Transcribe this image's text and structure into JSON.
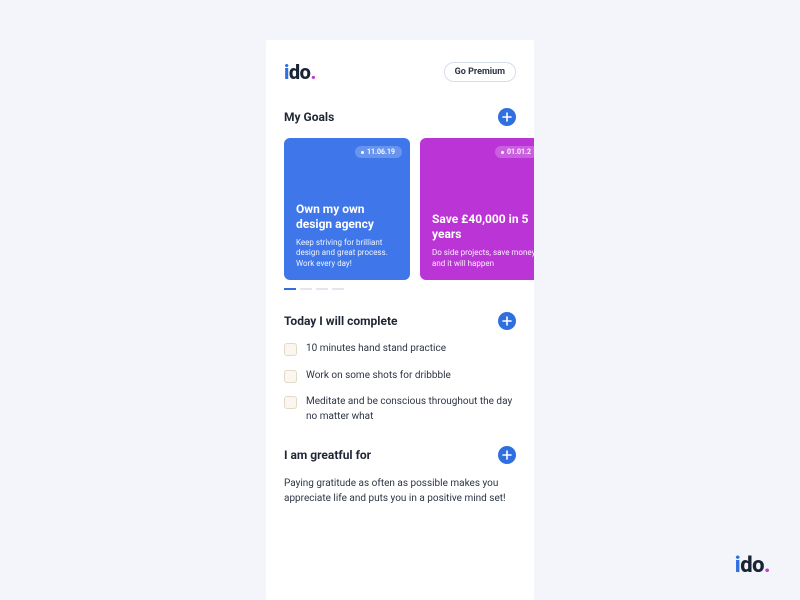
{
  "brand": {
    "name": "ido",
    "dot": "."
  },
  "header": {
    "premium_label": "Go Premium"
  },
  "colors": {
    "primary": "#2f6fe0",
    "accent": "#c23bd6",
    "card1_bg": "#3f77ea",
    "card2_bg": "#bb34d6"
  },
  "goals": {
    "title": "My Goals",
    "cards": [
      {
        "date": "11.06.19",
        "title": "Own my own design agency",
        "subtitle": "Keep striving for brilliant design and great process. Work every day!"
      },
      {
        "date": "01.01.2",
        "title": "Save £40,000 in 5 years",
        "subtitle": "Do side projects, save money and it will happen"
      }
    ],
    "pager_count": 4,
    "pager_active": 0
  },
  "today": {
    "title": "Today I will complete",
    "items": [
      {
        "label": "10 minutes hand stand practice"
      },
      {
        "label": "Work on some shots for dribbble"
      },
      {
        "label": "Meditate and be conscious throughout the day no matter what"
      }
    ]
  },
  "grateful": {
    "title": "I am greatful for",
    "body": "Paying gratitude as often as possible makes you appreciate life and puts you in a positive mind set!"
  }
}
